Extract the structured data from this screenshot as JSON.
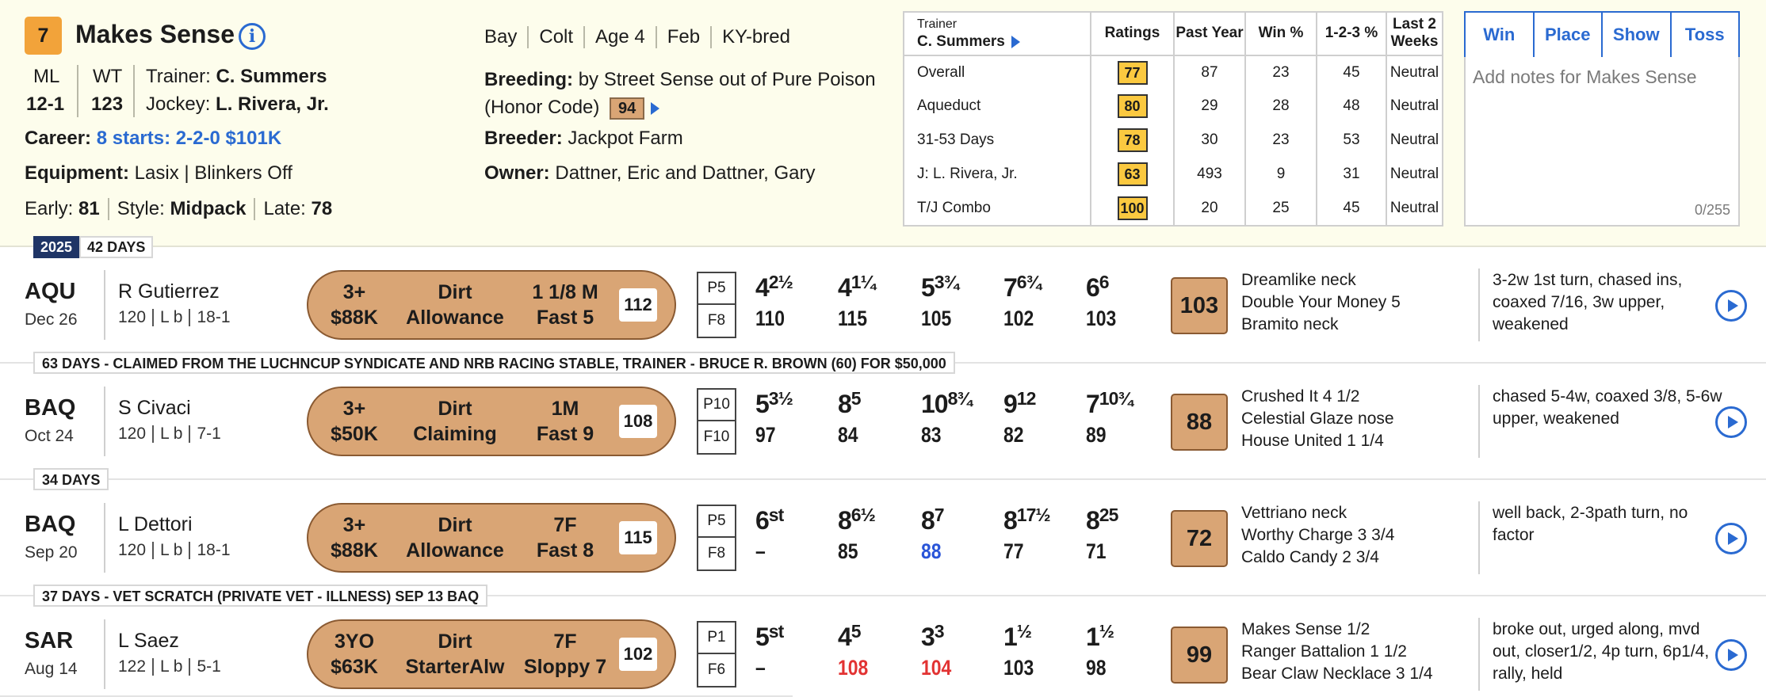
{
  "horse": {
    "program_number": "7",
    "name": "Makes Sense",
    "ml_label": "ML",
    "ml_value": "12-1",
    "wt_label": "WT",
    "wt_value": "123",
    "trainer_label": "Trainer:",
    "trainer": "C. Summers",
    "jockey_label": "Jockey:",
    "jockey": "L. Rivera, Jr.",
    "career_label": "Career:",
    "career": "8 starts: 2-2-0 $101K",
    "equipment_label": "Equipment:",
    "equipment": "Lasix | Blinkers Off",
    "early_label": "Early:",
    "early": "81",
    "style_label": "Style:",
    "style": "Midpack",
    "late_label": "Late:",
    "late": "78",
    "description": [
      "Bay",
      "Colt",
      "Age 4",
      "Feb",
      "KY-bred"
    ],
    "breeding_label": "Breeding:",
    "breeding": "by Street Sense out of Pure Poison",
    "breeding_line2": "(Honor Code)",
    "breeding_speed": "94",
    "breeder_label": "Breeder:",
    "breeder": "Jackpot Farm",
    "owner_label": "Owner:",
    "owner": "Dattner, Eric and Dattner, Gary"
  },
  "stats": {
    "header_top": "Trainer",
    "header_name": "C. Summers",
    "columns": [
      "Ratings",
      "Past Year",
      "Win %",
      "1-2-3 %",
      "Last 2 Weeks"
    ],
    "rows": [
      {
        "label": "Overall",
        "rating": "77",
        "past_year": "87",
        "win": "23",
        "itm": "45",
        "last2": "Neutral"
      },
      {
        "label": "Aqueduct",
        "rating": "80",
        "past_year": "29",
        "win": "28",
        "itm": "48",
        "last2": "Neutral"
      },
      {
        "label": "31-53 Days",
        "rating": "78",
        "past_year": "30",
        "win": "23",
        "itm": "53",
        "last2": "Neutral"
      },
      {
        "label": "J: L. Rivera, Jr.",
        "rating": "63",
        "past_year": "493",
        "win": "9",
        "itm": "31",
        "last2": "Neutral"
      },
      {
        "label": "T/J Combo",
        "rating": "100",
        "past_year": "20",
        "win": "25",
        "itm": "45",
        "last2": "Neutral"
      }
    ]
  },
  "wager": {
    "win": "Win",
    "place": "Place",
    "show": "Show",
    "toss": "Toss"
  },
  "notes": {
    "placeholder": "Add notes for Makes Sense",
    "count": "0/255"
  },
  "year_badge": "2025",
  "races": [
    {
      "gap": "42 DAYS",
      "track": "AQU",
      "date": "Dec 26",
      "jockey": "R Gutierrez",
      "weight": "120",
      "meds": "L b",
      "odds": "18-1",
      "age": "3+",
      "purse": "$88K",
      "surface": "Dirt",
      "race_type": "Allowance",
      "distance": "1 1/8 M",
      "condition": "Fast 5",
      "speed": "112",
      "post": "P5",
      "field": "F8",
      "calls": [
        {
          "pos": "4",
          "len": "2½",
          "fig": "110"
        },
        {
          "pos": "4",
          "len": "1¼",
          "fig": "115"
        },
        {
          "pos": "5",
          "len": "3¾",
          "fig": "105"
        },
        {
          "pos": "7",
          "len": "6¾",
          "fig": "102"
        },
        {
          "pos": "6",
          "len": "6",
          "fig": "103"
        }
      ],
      "figure": "103",
      "finishers": [
        "Dreamlike neck",
        "Double Your Money 5",
        "Bramito neck"
      ],
      "comment": "3-2w 1st turn, chased ins, coaxed 7/16, 3w upper, weakened"
    },
    {
      "gap": "63 DAYS - CLAIMED FROM THE LUCHNCUP SYNDICATE AND NRB RACING STABLE, TRAINER - BRUCE R. BROWN (60) FOR $50,000",
      "track": "BAQ",
      "date": "Oct 24",
      "jockey": "S Civaci",
      "weight": "120",
      "meds": "L b",
      "odds": "7-1",
      "age": "3+",
      "purse": "$50K",
      "surface": "Dirt",
      "race_type": "Claiming",
      "distance": "1M",
      "condition": "Fast 9",
      "speed": "108",
      "post": "P10",
      "field": "F10",
      "calls": [
        {
          "pos": "5",
          "len": "3½",
          "fig": "97"
        },
        {
          "pos": "8",
          "len": "5",
          "fig": "84"
        },
        {
          "pos": "10",
          "len": "8¾",
          "fig": "83"
        },
        {
          "pos": "9",
          "len": "12",
          "fig": "82"
        },
        {
          "pos": "7",
          "len": "10¾",
          "fig": "89"
        }
      ],
      "figure": "88",
      "finishers": [
        "Crushed It 4 1/2",
        "Celestial Glaze nose",
        "House United 1 1/4"
      ],
      "comment": "chased 5-4w, coaxed 3/8, 5-6w upper, weakened"
    },
    {
      "gap": "34 DAYS",
      "track": "BAQ",
      "date": "Sep 20",
      "jockey": "L Dettori",
      "weight": "120",
      "meds": "L b",
      "odds": "18-1",
      "age": "3+",
      "purse": "$88K",
      "surface": "Dirt",
      "race_type": "Allowance",
      "distance": "7F",
      "condition": "Fast 8",
      "speed": "115",
      "post": "P5",
      "field": "F8",
      "calls": [
        {
          "pos": "6",
          "len": "st",
          "fig": "–"
        },
        {
          "pos": "8",
          "len": "6½",
          "fig": "85"
        },
        {
          "pos": "8",
          "len": "7",
          "fig": "88",
          "color": "blue"
        },
        {
          "pos": "8",
          "len": "17½",
          "fig": "77"
        },
        {
          "pos": "8",
          "len": "25",
          "fig": "71"
        }
      ],
      "figure": "72",
      "finishers": [
        "Vettriano neck",
        "Worthy Charge 3 3/4",
        "Caldo Candy 2 3/4"
      ],
      "comment": "well back, 2-3path turn, no factor"
    },
    {
      "gap": "37 DAYS - VET SCRATCH (PRIVATE VET - ILLNESS) SEP 13 BAQ",
      "track": "SAR",
      "date": "Aug 14",
      "jockey": "L Saez",
      "weight": "122",
      "meds": "L b",
      "odds": "5-1",
      "age": "3YO",
      "purse": "$63K",
      "surface": "Dirt",
      "race_type": "StarterAlw",
      "distance": "7F",
      "condition": "Sloppy 7",
      "speed": "102",
      "post": "P1",
      "field": "F6",
      "calls": [
        {
          "pos": "5",
          "len": "st",
          "fig": "–"
        },
        {
          "pos": "4",
          "len": "5",
          "fig": "108",
          "color": "red"
        },
        {
          "pos": "3",
          "len": "3",
          "fig": "104",
          "color": "red"
        },
        {
          "pos": "1",
          "len": "½",
          "fig": "103"
        },
        {
          "pos": "1",
          "len": "½",
          "fig": "98"
        }
      ],
      "figure": "99",
      "finishers": [
        "Makes Sense 1/2",
        "Ranger Battalion 1 1/2",
        "Bear Claw Necklace 3 1/4"
      ],
      "comment": "broke out, urged along, mvd out, closer1/2, 4p turn, 6p1/4, rally, held"
    }
  ]
}
